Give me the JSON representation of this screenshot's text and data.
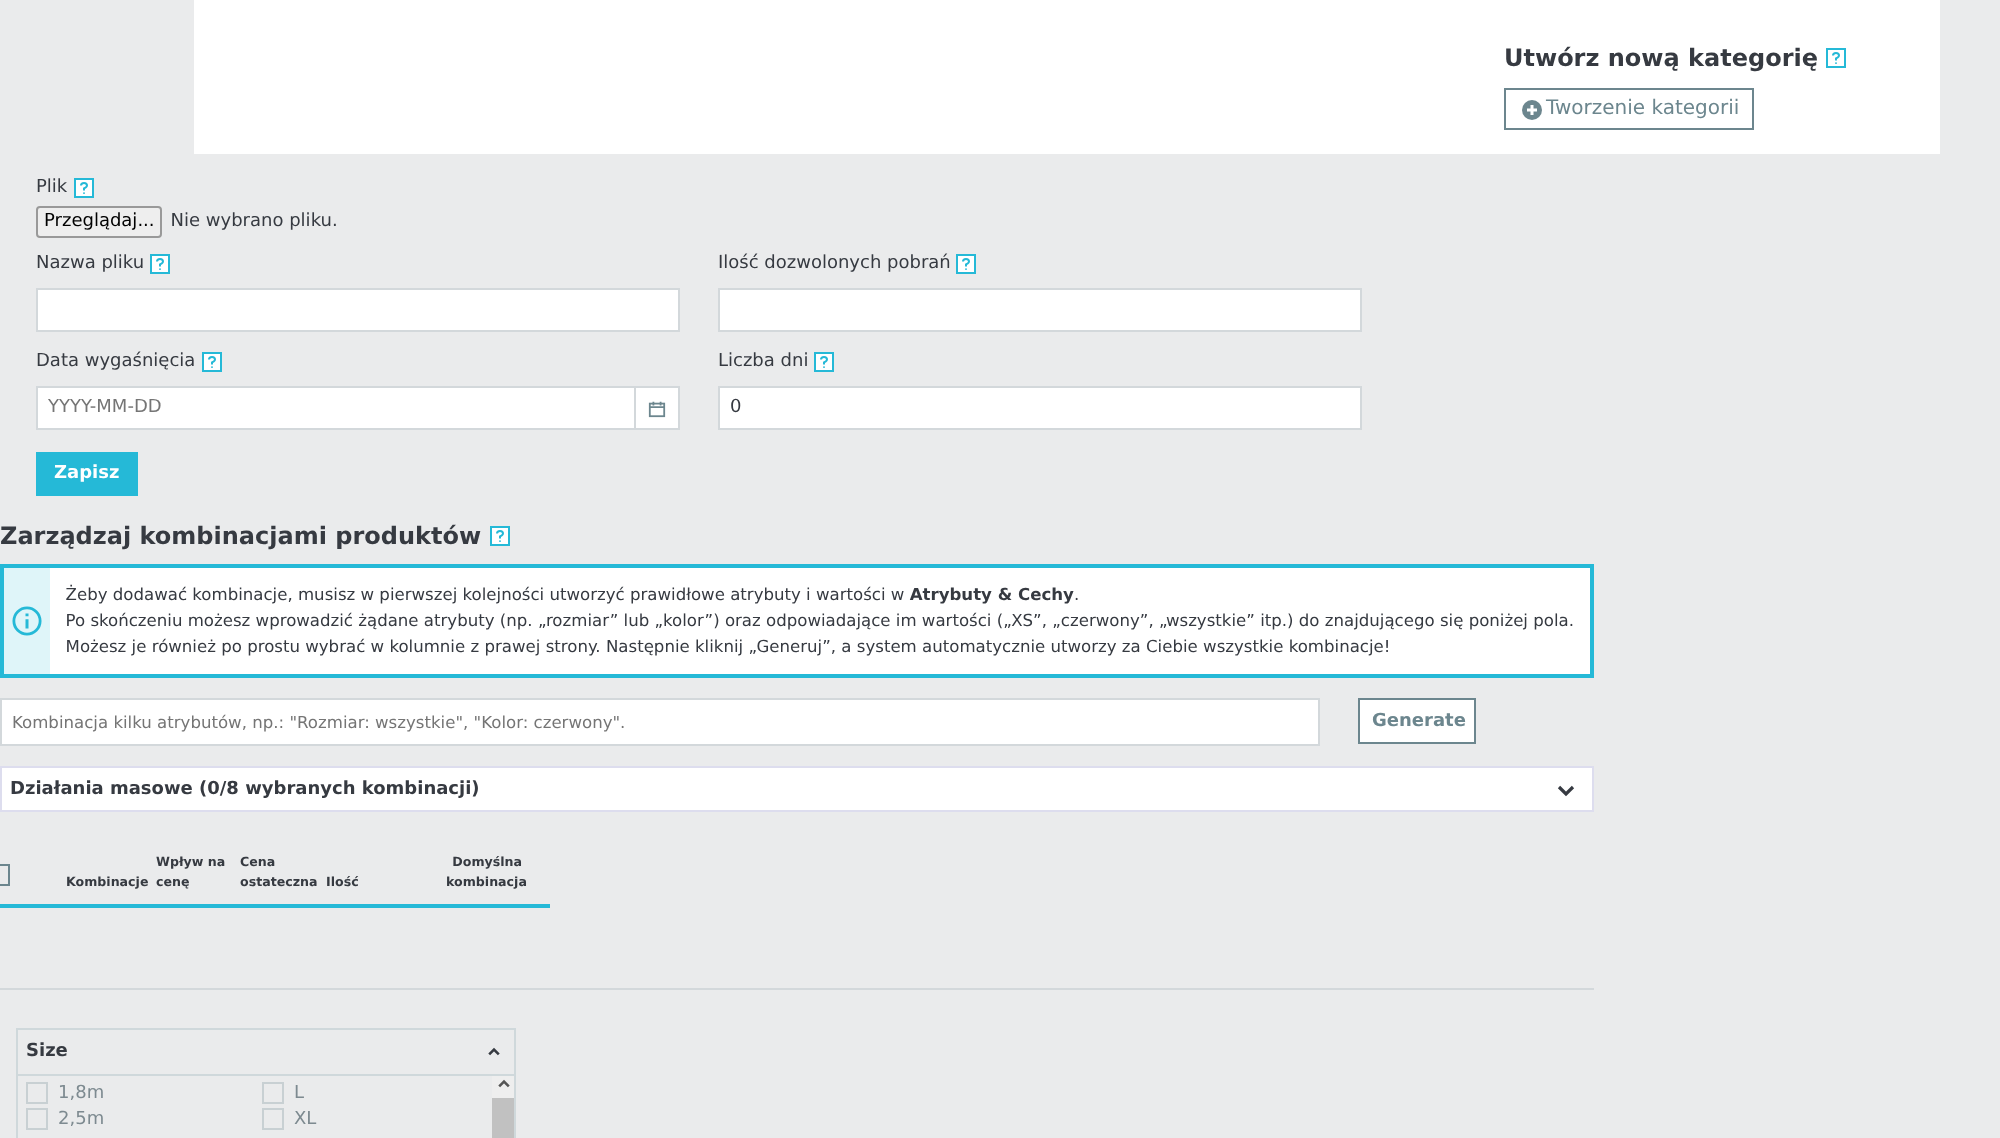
{
  "category": {
    "title": "Utwórz nową kategorię",
    "button": "Tworzenie kategorii"
  },
  "file": {
    "label": "Plik",
    "browse": "Przeglądaj...",
    "status": "Nie wybrano pliku."
  },
  "fields": [
    {
      "label": "Nazwa pliku",
      "kind": "text"
    },
    {
      "label": "Ilość dozwolonych pobrań",
      "kind": "text"
    },
    {
      "label": "Data wygaśnięcia",
      "placeholder": "YYYY-MM-DD",
      "kind": "date"
    },
    {
      "label": "Liczba dni",
      "value": "0",
      "kind": "text"
    }
  ],
  "save_button": "Zapisz",
  "combinations": {
    "title": "Zarządzaj kombinacjami produktów",
    "info": [
      "Żeby dodawać kombinacje, musisz w pierwszej kolejności utworzyć prawidłowe atrybuty i wartości w **Atrybuty & Cechy**.",
      "Po skończeniu możesz wprowadzić żądane atrybuty (np. „rozmiar” lub „kolor”) oraz odpowiadające im wartości („XS”, „czerwony”, „wszystkie” itp.) do znajdującego się poniżej pola.",
      "Możesz je również po prostu wybrać w kolumnie z prawej strony. Następnie kliknij „Generuj”, a system automatycznie utworzy za Ciebie wszystkie kombinacje!"
    ],
    "search_placeholder": "Kombinacja kilku atrybutów, np.: \"Rozmiar: wszystkie\", \"Kolor: czerwony\".",
    "generate_button": "Generate",
    "bulk": {
      "label": "Działania masowe (0/8 wybranych kombinacji)",
      "expanded": false
    },
    "select_all_checked": false,
    "columns": [
      "Kombinacje",
      "Wpływ na cenę",
      "Cena ostateczna",
      "Ilość",
      "Domyślna kombinacja"
    ]
  },
  "attributes": {
    "title": "Size",
    "expanded": true,
    "values": [
      {
        "label": "1,8m",
        "checked": false
      },
      {
        "label": "L",
        "checked": false
      },
      {
        "label": "2,5m",
        "checked": false
      },
      {
        "label": "XL",
        "checked": false
      }
    ]
  }
}
